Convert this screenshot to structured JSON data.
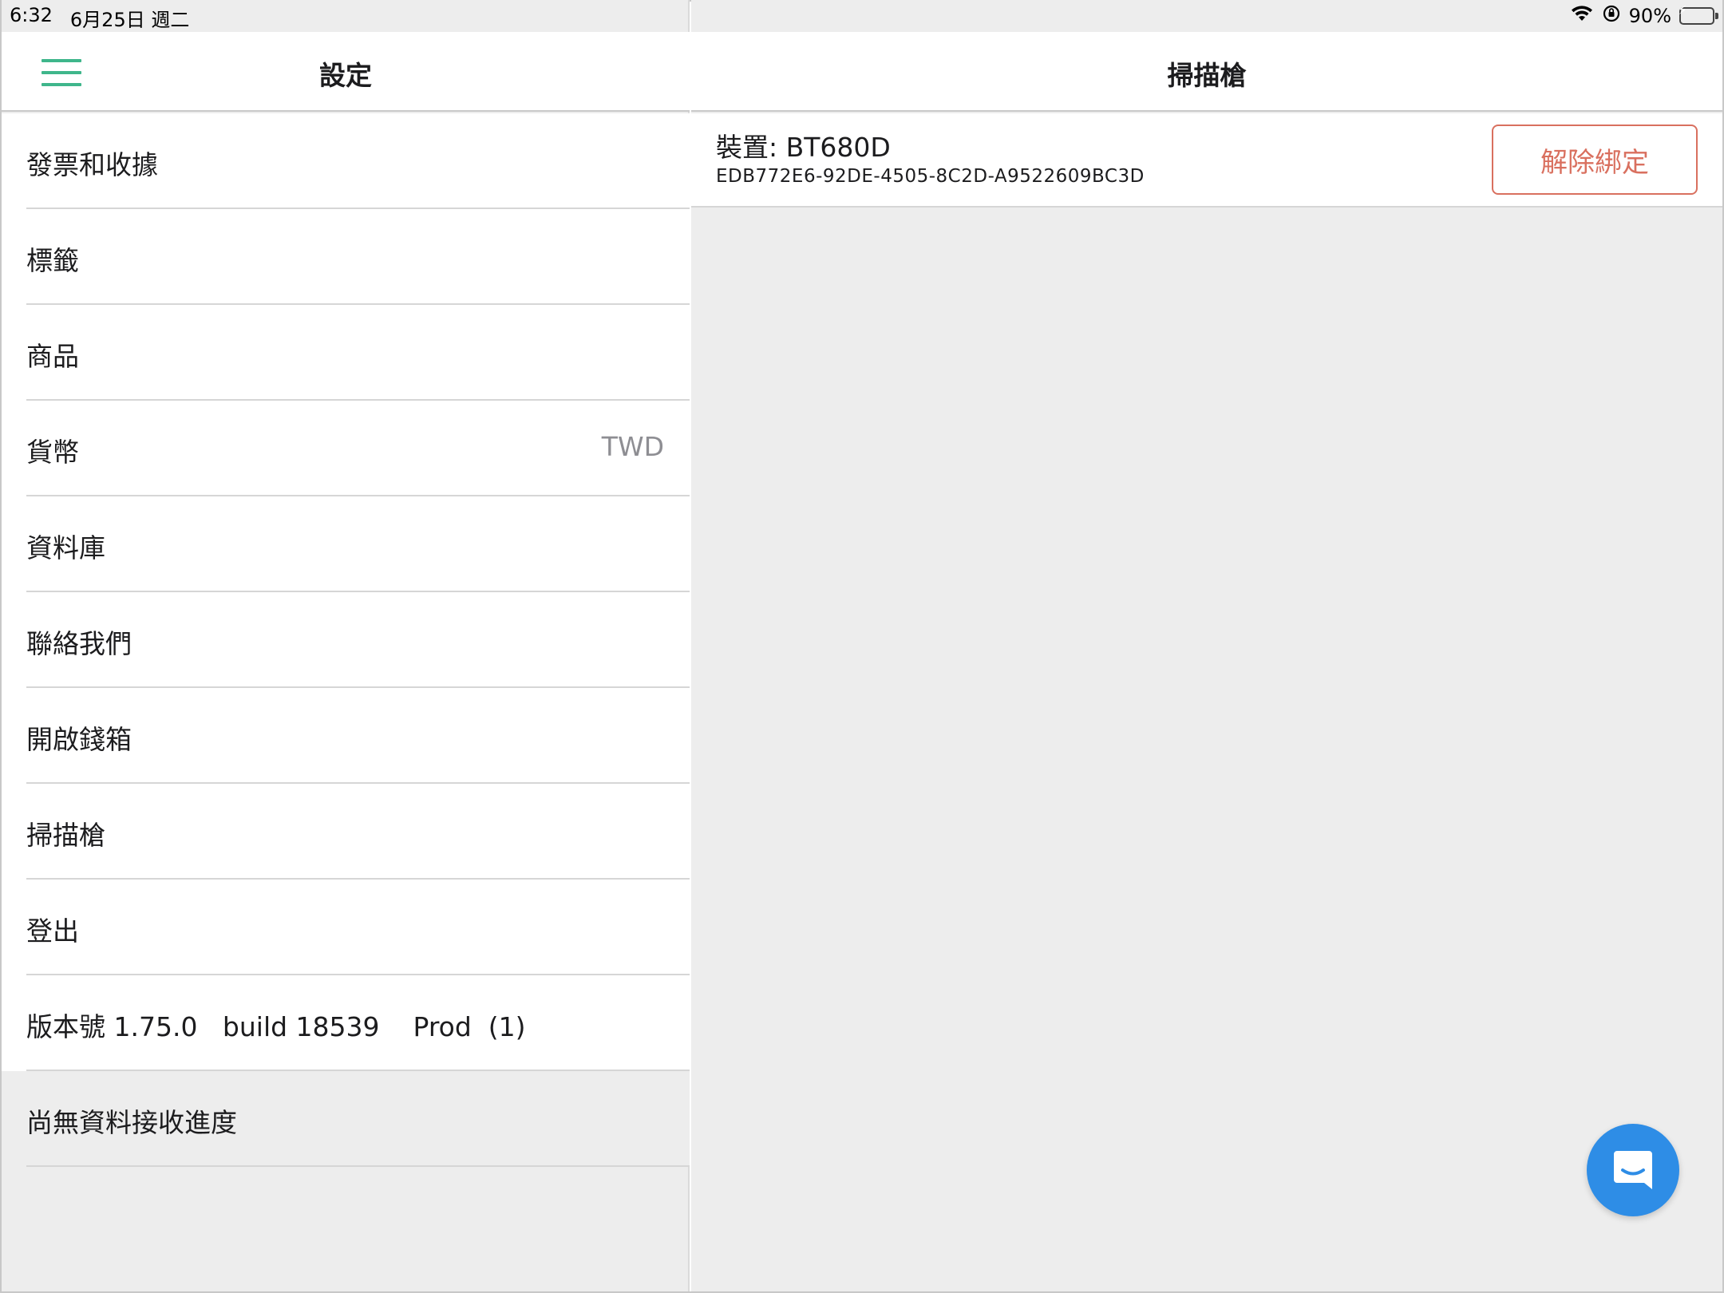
{
  "status_bar": {
    "time": "6:32",
    "date": "6月25日 週二",
    "battery": "90%",
    "wifi_icon": "wifi-icon",
    "orientation_lock_icon": "orientation-lock-icon",
    "battery_icon": "battery-charging-icon"
  },
  "left": {
    "title": "設定",
    "menu_icon": "hamburger-menu-icon",
    "items": [
      {
        "label": "發票和收據"
      },
      {
        "label": "標籤"
      },
      {
        "label": "商品"
      },
      {
        "label": "貨幣",
        "value": "TWD"
      },
      {
        "label": "資料庫"
      },
      {
        "label": "聯絡我們"
      },
      {
        "label": "開啟錢箱"
      },
      {
        "label": "掃描槍"
      },
      {
        "label": "登出"
      },
      {
        "label": "版本號 1.75.0   build 18539    Prod  (1)"
      },
      {
        "label": "尚無資料接收進度"
      }
    ]
  },
  "right": {
    "title": "掃描槍",
    "device": {
      "name": "裝置: BT680D",
      "uuid": "EDB772E6-92DE-4505-8C2D-A9522609BC3D",
      "unbind_label": "解除綁定"
    }
  },
  "colors": {
    "accent_green": "#3fb68b",
    "unbind_red": "#d9705f",
    "fab_blue": "#2e8de6",
    "panel_grey": "#ededed"
  },
  "chat_icon": "chat-bubble-icon"
}
